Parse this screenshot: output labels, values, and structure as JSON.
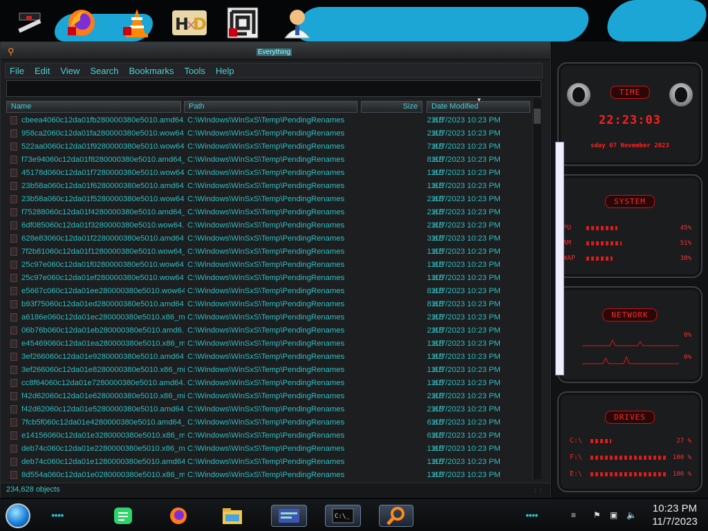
{
  "desktop_icons": [
    {
      "name": "tool-app-icon"
    },
    {
      "name": "firefox-icon"
    },
    {
      "name": "vlc-icon"
    },
    {
      "name": "hxd-icon"
    },
    {
      "name": "maze-app-icon"
    },
    {
      "name": "user-avatar-icon"
    }
  ],
  "window": {
    "title": "Everything",
    "menu": [
      "File",
      "Edit",
      "View",
      "Search",
      "Bookmarks",
      "Tools",
      "Help"
    ],
    "search": {
      "value": "",
      "placeholder": ""
    },
    "columns": {
      "name": "Name",
      "path": "Path",
      "size": "Size",
      "date": "Date Modified"
    },
    "rows": [
      {
        "name": "cbeea4060c12da01fb280000380e5010.amd64...",
        "path": "C:\\Windows\\WinSxS\\Temp\\PendingRenames",
        "size": "2 KB",
        "date": "11/7/2023 10:23 PM"
      },
      {
        "name": "958ca2060c12da01fa280000380e5010.wow64...",
        "path": "C:\\Windows\\WinSxS\\Temp\\PendingRenames",
        "size": "2 KB",
        "date": "11/7/2023 10:23 PM"
      },
      {
        "name": "522aa0060c12da01f9280000380e5010.wow64...",
        "path": "C:\\Windows\\WinSxS\\Temp\\PendingRenames",
        "size": "7 KB",
        "date": "11/7/2023 10:23 PM"
      },
      {
        "name": "f73e94060c12da01f8280000380e5010.amd64_...",
        "path": "C:\\Windows\\WinSxS\\Temp\\PendingRenames",
        "size": "8 KB",
        "date": "11/7/2023 10:23 PM"
      },
      {
        "name": "45178d060c12da01f7280000380e5010.wow64...",
        "path": "C:\\Windows\\WinSxS\\Temp\\PendingRenames",
        "size": "1 KB",
        "date": "11/7/2023 10:23 PM"
      },
      {
        "name": "23b58a060c12da01f6280000380e5010.amd64...",
        "path": "C:\\Windows\\WinSxS\\Temp\\PendingRenames",
        "size": "1 KB",
        "date": "11/7/2023 10:23 PM"
      },
      {
        "name": "23b58a060c12da01f5280000380e5010.wow64...",
        "path": "C:\\Windows\\WinSxS\\Temp\\PendingRenames",
        "size": "2 KB",
        "date": "11/7/2023 10:23 PM"
      },
      {
        "name": "f75288060c12da01f4280000380e5010.amd64_...",
        "path": "C:\\Windows\\WinSxS\\Temp\\PendingRenames",
        "size": "2 KB",
        "date": "11/7/2023 10:23 PM"
      },
      {
        "name": "6df085060c12da01f3280000380e5010.wow64...",
        "path": "C:\\Windows\\WinSxS\\Temp\\PendingRenames",
        "size": "2 KB",
        "date": "11/7/2023 10:23 PM"
      },
      {
        "name": "628e83060c12da01f2280000380e5010.amd64...",
        "path": "C:\\Windows\\WinSxS\\Temp\\PendingRenames",
        "size": "3 KB",
        "date": "11/7/2023 10:23 PM"
      },
      {
        "name": "7f2b81060c12da01f1280000380e5010.wow64_...",
        "path": "C:\\Windows\\WinSxS\\Temp\\PendingRenames",
        "size": "1 KB",
        "date": "11/7/2023 10:23 PM"
      },
      {
        "name": "25c97e060c12da01f0280000380e5010.wow64...",
        "path": "C:\\Windows\\WinSxS\\Temp\\PendingRenames",
        "size": "1 KB",
        "date": "11/7/2023 10:23 PM"
      },
      {
        "name": "25c97e060c12da01ef280000380e5010.wow64...",
        "path": "C:\\Windows\\WinSxS\\Temp\\PendingRenames",
        "size": "1 KB",
        "date": "11/7/2023 10:23 PM"
      },
      {
        "name": "e5667c060c12da01ee280000380e5010.wow64...",
        "path": "C:\\Windows\\WinSxS\\Temp\\PendingRenames",
        "size": "8 KB",
        "date": "11/7/2023 10:23 PM"
      },
      {
        "name": "b93f75060c12da01ed280000380e5010.amd64...",
        "path": "C:\\Windows\\WinSxS\\Temp\\PendingRenames",
        "size": "8 KB",
        "date": "11/7/2023 10:23 PM"
      },
      {
        "name": "a6186e060c12da01ec280000380e5010.x86_mi...",
        "path": "C:\\Windows\\WinSxS\\Temp\\PendingRenames",
        "size": "2 KB",
        "date": "11/7/2023 10:23 PM"
      },
      {
        "name": "06b76b060c12da01eb280000380e5010.amd6...",
        "path": "C:\\Windows\\WinSxS\\Temp\\PendingRenames",
        "size": "2 KB",
        "date": "11/7/2023 10:23 PM"
      },
      {
        "name": "e45469060c12da01ea280000380e5010.x86_mi...",
        "path": "C:\\Windows\\WinSxS\\Temp\\PendingRenames",
        "size": "1 KB",
        "date": "11/7/2023 10:23 PM"
      },
      {
        "name": "3ef266060c12da01e9280000380e5010.amd64...",
        "path": "C:\\Windows\\WinSxS\\Temp\\PendingRenames",
        "size": "1 KB",
        "date": "11/7/2023 10:23 PM"
      },
      {
        "name": "3ef266060c12da01e8280000380e5010.x86_mi...",
        "path": "C:\\Windows\\WinSxS\\Temp\\PendingRenames",
        "size": "1 KB",
        "date": "11/7/2023 10:23 PM"
      },
      {
        "name": "cc8f64060c12da01e7280000380e5010.amd64...",
        "path": "C:\\Windows\\WinSxS\\Temp\\PendingRenames",
        "size": "1 KB",
        "date": "11/7/2023 10:23 PM"
      },
      {
        "name": "f42d62060c12da01e6280000380e5010.x86_mi...",
        "path": "C:\\Windows\\WinSxS\\Temp\\PendingRenames",
        "size": "2 KB",
        "date": "11/7/2023 10:23 PM"
      },
      {
        "name": "f42d62060c12da01e5280000380e5010.amd64...",
        "path": "C:\\Windows\\WinSxS\\Temp\\PendingRenames",
        "size": "2 KB",
        "date": "11/7/2023 10:23 PM"
      },
      {
        "name": "7fcb5f060c12da01e4280000380e5010.amd64_...",
        "path": "C:\\Windows\\WinSxS\\Temp\\PendingRenames",
        "size": "6 KB",
        "date": "11/7/2023 10:23 PM"
      },
      {
        "name": "e14156060c12da01e3280000380e5010.x86_mi...",
        "path": "C:\\Windows\\WinSxS\\Temp\\PendingRenames",
        "size": "6 KB",
        "date": "11/7/2023 10:23 PM"
      },
      {
        "name": "deb74c060c12da01e2280000380e5010.x86_m...",
        "path": "C:\\Windows\\WinSxS\\Temp\\PendingRenames",
        "size": "1 KB",
        "date": "11/7/2023 10:23 PM"
      },
      {
        "name": "deb74c060c12da01e1280000380e5010.amd64...",
        "path": "C:\\Windows\\WinSxS\\Temp\\PendingRenames",
        "size": "1 KB",
        "date": "11/7/2023 10:23 PM"
      },
      {
        "name": "8d554a060c12da01e0280000380e5010.x86_m...",
        "path": "C:\\Windows\\WinSxS\\Temp\\PendingRenames",
        "size": "1 KB",
        "date": "11/7/2023 10:23 PM"
      }
    ],
    "status": "234,628 objects"
  },
  "gadgets": {
    "time": {
      "title": "TIME",
      "clock": "22:23:03",
      "date": "sday 07 November 2023"
    },
    "system": {
      "title": "SYSTEM",
      "items": [
        {
          "label": "PU",
          "value": "45%",
          "level": 0.45
        },
        {
          "label": "AM",
          "value": "51%",
          "level": 0.51
        },
        {
          "label": "WAP",
          "value": "38%",
          "level": 0.38
        }
      ]
    },
    "network": {
      "title": "NETWORK",
      "values": [
        "0%",
        "0%"
      ]
    },
    "drives": {
      "title": "DRIVES",
      "items": [
        {
          "label": "C:\\",
          "value": "27 %",
          "level": 0.27
        },
        {
          "label": "F:\\",
          "value": "100 %",
          "level": 1.0
        },
        {
          "label": "E:\\",
          "value": "100 %",
          "level": 1.0
        }
      ]
    }
  },
  "taskbar": {
    "apps": [
      {
        "name": "notes-app-icon",
        "active": false
      },
      {
        "name": "firefox-icon",
        "active": false
      },
      {
        "name": "file-explorer-icon",
        "active": false
      },
      {
        "name": "id-card-app-icon",
        "active": true
      },
      {
        "name": "terminal-icon",
        "active": true
      },
      {
        "name": "everything-search-icon",
        "active": true
      }
    ],
    "time": "10:23 PM",
    "date": "11/7/2023"
  },
  "colors": {
    "accent_cyan": "#2fbfc2",
    "gadget_red": "#ff2626",
    "wallpaper_blue": "#1ca6d6"
  }
}
